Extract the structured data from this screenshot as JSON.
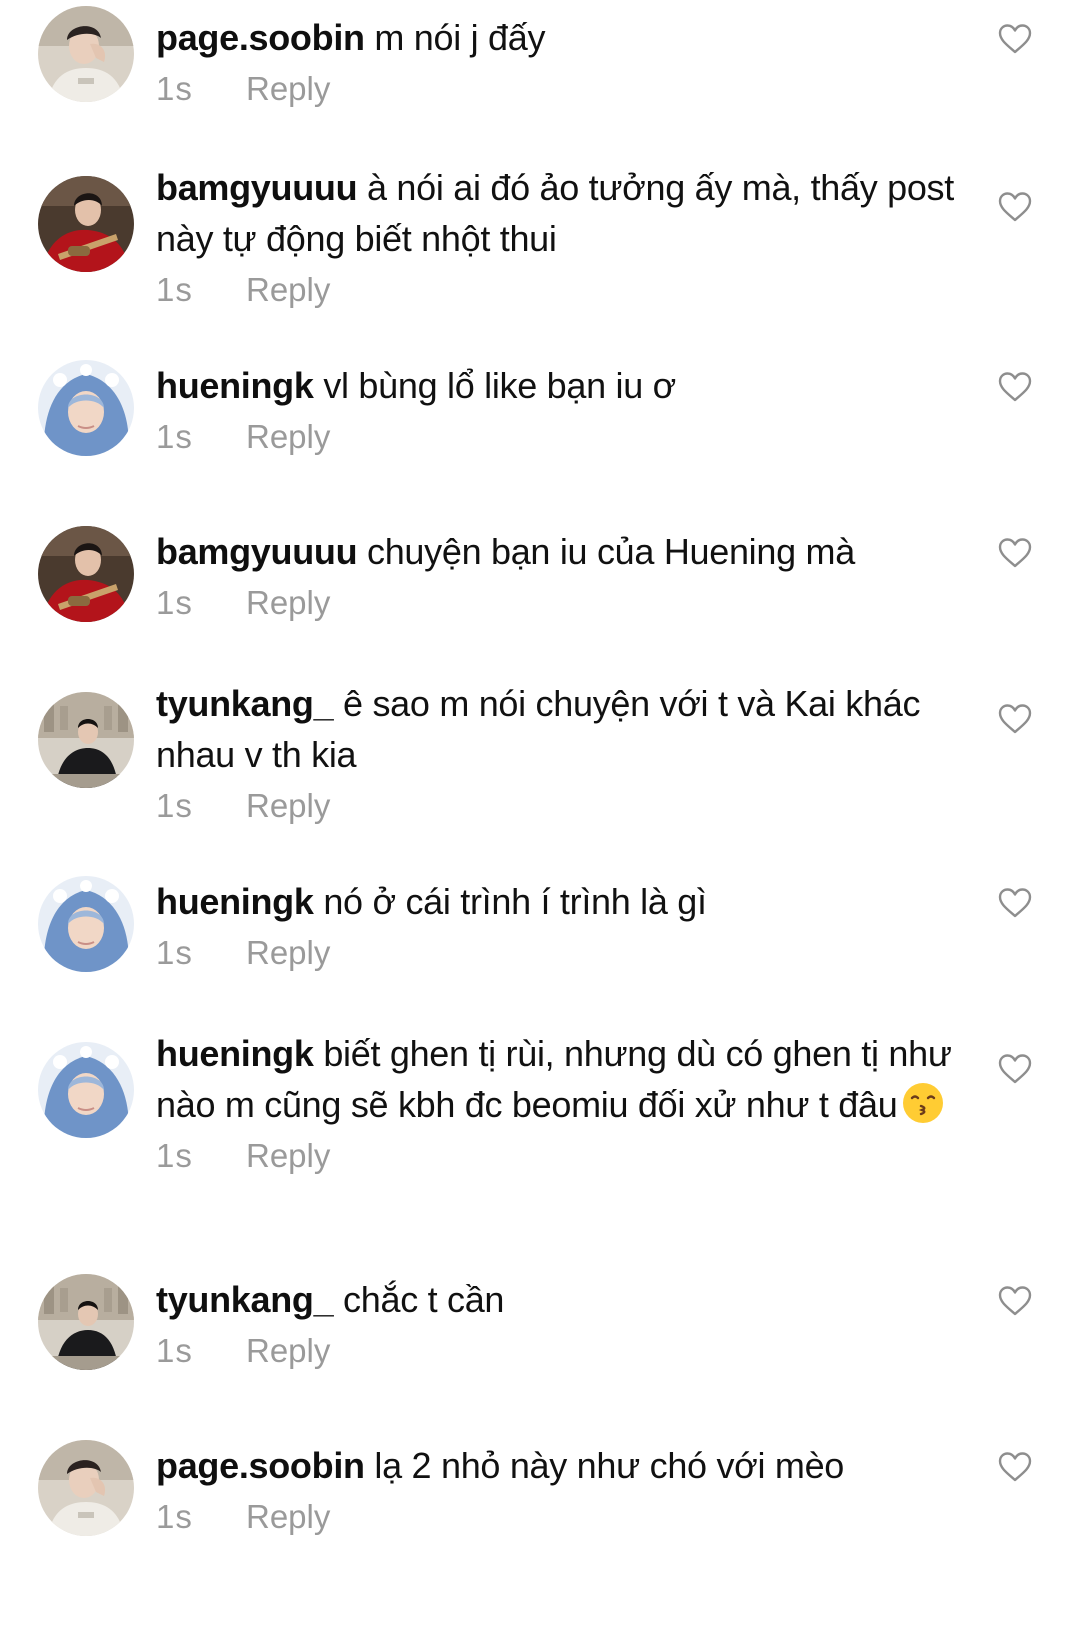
{
  "comments": [
    {
      "username": "page.soobin",
      "message": "m nói j đấy",
      "time": "1s",
      "reply_label": "Reply",
      "avatar": "soobin",
      "emoji": null
    },
    {
      "username": "bamgyuuuu",
      "message": "à nói ai đó ảo tưởng ấy mà, thấy post này tự động biết nhột thui",
      "time": "1s",
      "reply_label": "Reply",
      "avatar": "beomgyu",
      "emoji": null
    },
    {
      "username": "hueningk",
      "message": "vl bùng lổ like bạn iu ơ",
      "time": "1s",
      "reply_label": "Reply",
      "avatar": "huening",
      "emoji": null
    },
    {
      "username": "bamgyuuuu",
      "message": "chuyện bạn iu của Huening mà",
      "time": "1s",
      "reply_label": "Reply",
      "avatar": "beomgyu",
      "emoji": null
    },
    {
      "username": "tyunkang_",
      "message": "ê sao m nói chuyện với t và Kai khác nhau v th kia",
      "time": "1s",
      "reply_label": "Reply",
      "avatar": "taehyun",
      "emoji": null
    },
    {
      "username": "hueningk",
      "message": "nó ở cái trình í trình là gì",
      "time": "1s",
      "reply_label": "Reply",
      "avatar": "huening",
      "emoji": null
    },
    {
      "username": "hueningk",
      "message": "biết ghen tị rùi, nhưng dù có ghen tị như nào m cũng sẽ kbh đc beomiu đối xử như t đâu",
      "time": "1s",
      "reply_label": "Reply",
      "avatar": "huening",
      "emoji": "kissing-face-emoji"
    },
    {
      "username": "tyunkang_",
      "message": "chắc t cần",
      "time": "1s",
      "reply_label": "Reply",
      "avatar": "taehyun",
      "emoji": null
    },
    {
      "username": "page.soobin",
      "message": "lạ 2 nhỏ này như chó với mèo",
      "time": "1s",
      "reply_label": "Reply",
      "avatar": "soobin",
      "emoji": null
    }
  ],
  "icons": {
    "like": "heart-outline-icon"
  },
  "colors": {
    "text": "#111111",
    "muted": "#9a9a9a",
    "heart_stroke": "#8e8e8e",
    "background": "#ffffff"
  }
}
